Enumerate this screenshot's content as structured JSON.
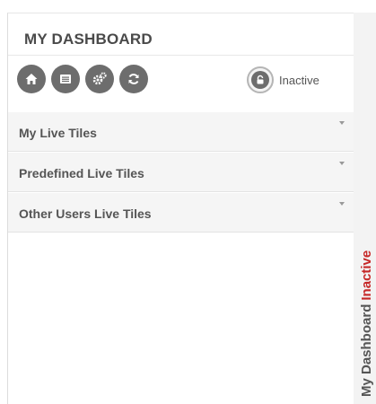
{
  "dashboard": {
    "title": "MY DASHBOARD",
    "lock_status": "Inactive"
  },
  "toolbar": {
    "buttons": [
      {
        "icon": "home-icon"
      },
      {
        "icon": "list-icon"
      },
      {
        "icon": "settings-icon"
      },
      {
        "icon": "refresh-icon"
      }
    ],
    "lock_icon": "lock-icon"
  },
  "sections": [
    {
      "label": "My Live Tiles"
    },
    {
      "label": "Predefined Live Tiles"
    },
    {
      "label": "Other Users Live Tiles"
    }
  ],
  "side_tab": {
    "label": "My Dashboard",
    "status": "Inactive",
    "status_color": "#c62828"
  }
}
